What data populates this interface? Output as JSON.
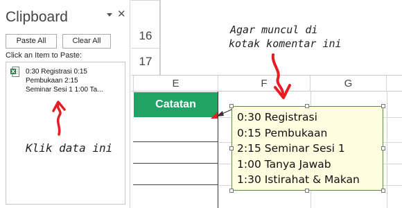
{
  "clipboard": {
    "title": "Clipboard",
    "paste_all_label": "Paste All",
    "clear_all_label": "Clear All",
    "hint": "Click an Item to Paste:",
    "item": {
      "lines": [
        "0:30 Registrasi 0:15",
        "Pembukaan 2:15",
        "Seminar Sesi 1 1:00 Ta..."
      ]
    }
  },
  "sheet": {
    "row_headers": [
      "16",
      "17"
    ],
    "column_headers": [
      "E",
      "F",
      "G"
    ],
    "header_cell": "Catatan",
    "header_fill": "#21a366",
    "comment_indicator_color": "#d9232b"
  },
  "comment": {
    "lines": [
      "0:30 Registrasi",
      "0:15 Pembukaan",
      "2:15 Seminar Sesi 1",
      "1:00 Tanya Jawab",
      "1:30 Istirahat & Makan"
    ],
    "background": "#fdfde0"
  },
  "annotations": {
    "top_line1": "Agar muncul di",
    "top_line2": "kotak komentar ini",
    "bottom": "Klik data ini",
    "arrow_color": "#e81c24"
  }
}
